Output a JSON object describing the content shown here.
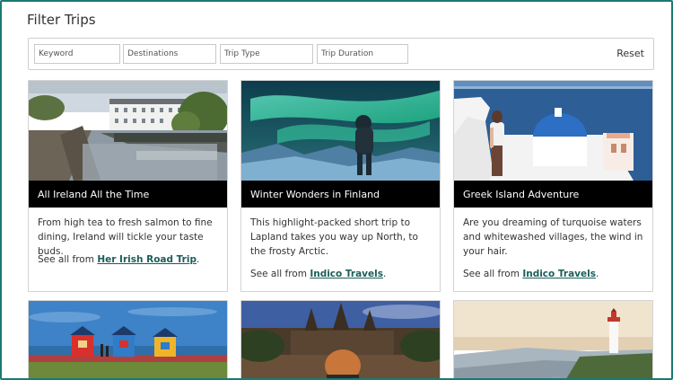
{
  "page": {
    "title": "Filter Trips"
  },
  "filters": {
    "keyword_placeholder": "Keyword",
    "destinations_placeholder": "Destinations",
    "trip_type_placeholder": "Trip Type",
    "trip_duration_placeholder": "Trip Duration",
    "reset_label": "Reset"
  },
  "cards": [
    {
      "title": "All Ireland All the Time",
      "description": "From high tea to fresh salmon to fine dining, Ireland will tickle your taste buds.",
      "from_prefix": "See all from",
      "from_link": "Her Irish Road Trip",
      "from_suffix": "."
    },
    {
      "title": "Winter Wonders in Finland",
      "description": "This highlight-packed short trip to Lapland takes you way up North, to the frosty Arctic.",
      "from_prefix": "See all from",
      "from_link": "Indico Travels",
      "from_suffix": "."
    },
    {
      "title": "Greek Island Adventure",
      "description": "Are you dreaming of turquoise waters and whitewashed villages, the wind in your hair.",
      "from_prefix": "See all from",
      "from_link": "Indico Travels",
      "from_suffix": "."
    }
  ],
  "colors": {
    "accent": "#1b7a72",
    "link": "#1b5e5a",
    "band": "#000000"
  }
}
